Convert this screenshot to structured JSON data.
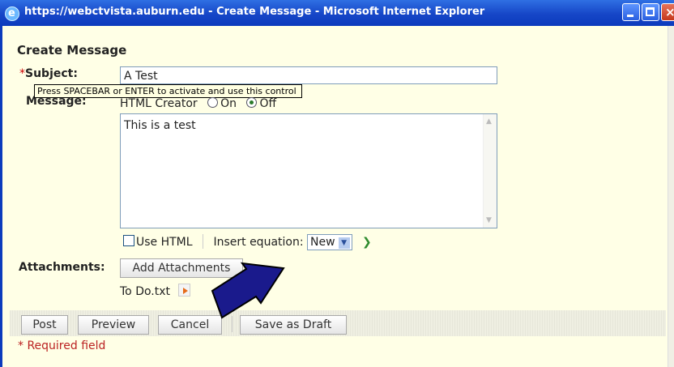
{
  "window": {
    "title": "https://webctvista.auburn.edu - Create Message - Microsoft Internet Explorer"
  },
  "form": {
    "heading": "Create Message",
    "required_marker": "*",
    "subject_label": "Subject:",
    "subject_value": "A Test",
    "tooltip": "Press SPACEBAR or ENTER to activate and use this control",
    "message_label": "Message:",
    "html_creator_label": "HTML Creator",
    "radio_on": "On",
    "radio_off": "Off",
    "message_body": "This is a test",
    "use_html_label": "Use HTML",
    "insert_equation_label": "Insert equation:",
    "equation_option": "New",
    "attachments_label": "Attachments:",
    "add_attachments_label": "Add Attachments",
    "attachment_file": "To Do.txt"
  },
  "actions": {
    "post": "Post",
    "preview": "Preview",
    "cancel": "Cancel",
    "save_draft": "Save as Draft"
  },
  "footer": {
    "required_note": "* Required field"
  },
  "colors": {
    "background": "#ffffe6",
    "titlebar": "#1646c7",
    "arrow": "#1a1a8c",
    "required": "#cc0000"
  }
}
